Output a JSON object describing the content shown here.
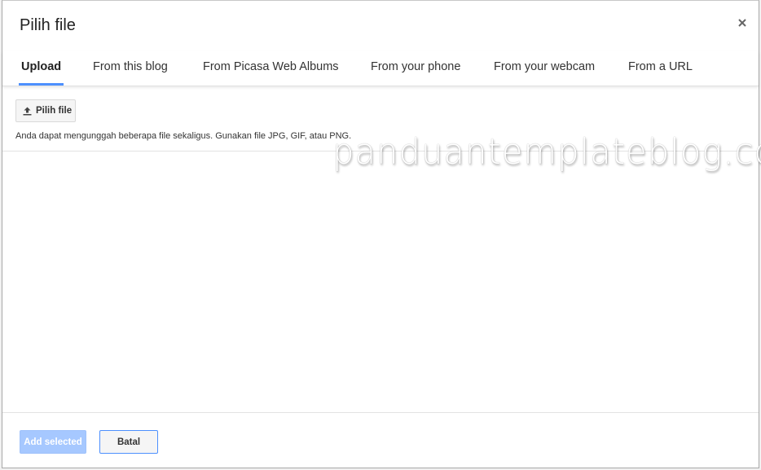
{
  "dialog": {
    "title": "Pilih file",
    "close_icon": "close-icon"
  },
  "tabs": [
    {
      "label": "Upload",
      "active": true
    },
    {
      "label": "From this blog",
      "active": false
    },
    {
      "label": "From Picasa Web Albums",
      "active": false
    },
    {
      "label": "From your phone",
      "active": false
    },
    {
      "label": "From your webcam",
      "active": false
    },
    {
      "label": "From a URL",
      "active": false
    }
  ],
  "upload": {
    "button_label": "Pilih file",
    "button_icon": "upload-icon",
    "hint": "Anda dapat mengunggah beberapa file sekaligus. Gunakan file JPG, GIF, atau PNG."
  },
  "watermark": "panduantemplateblog.com",
  "footer": {
    "add_label": "Add selected",
    "cancel_label": "Batal"
  },
  "colors": {
    "accent": "#4d90fe",
    "disabled_button": "#a6c8ff"
  }
}
